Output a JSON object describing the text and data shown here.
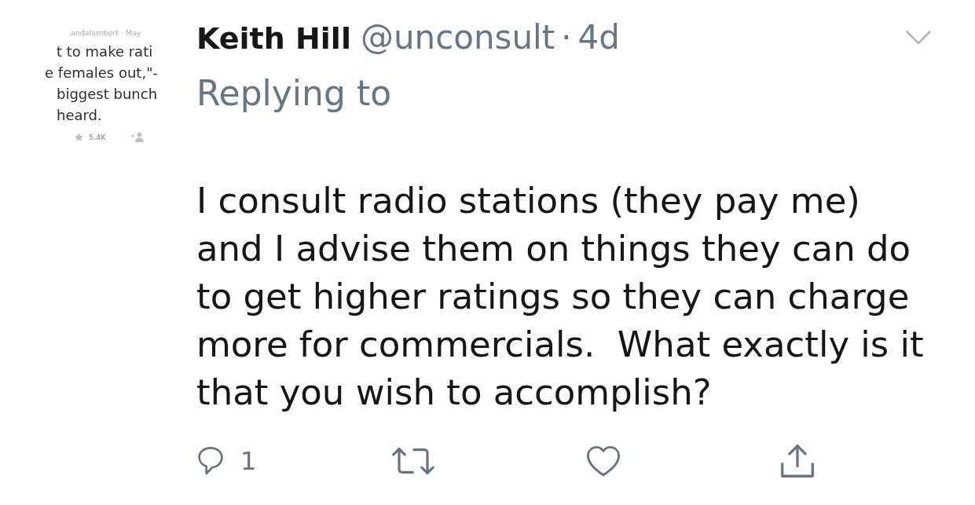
{
  "quoted_fragment": {
    "author_line": "andalambert · May",
    "lines": [
      "t to make rati",
      "e females out,\"-",
      "biggest bunch",
      "heard."
    ],
    "stats": [
      {
        "kind": "star",
        "count": "5.4K"
      },
      {
        "kind": "follow"
      }
    ]
  },
  "tweet": {
    "name": "Keith Hill",
    "handle": "@unconsult",
    "separator": "·",
    "time": "4d",
    "replying_to": "Replying to",
    "text": "I consult radio stations (they pay me) and I advise them on things they can do to get higher ratings so they can charge more for commercials.  What exactly is it that you wish to accomplish?",
    "actions": [
      {
        "kind": "reply",
        "count": "1"
      },
      {
        "kind": "retweet"
      },
      {
        "kind": "like"
      },
      {
        "kind": "share"
      }
    ]
  }
}
